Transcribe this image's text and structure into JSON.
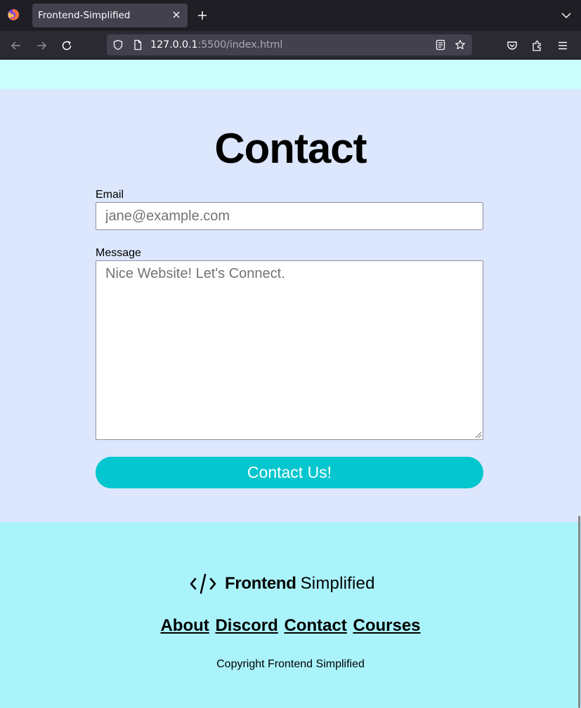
{
  "browser": {
    "tab_title": "Frontend-Simplified",
    "url_host": "127.0.0.1",
    "url_rest": ":5500/index.html"
  },
  "contact": {
    "title": "Contact",
    "email_label": "Email",
    "email_placeholder": "jane@example.com",
    "message_label": "Message",
    "message_placeholder": "Nice Website! Let's Connect.",
    "submit_label": "Contact Us!"
  },
  "footer": {
    "brand_bold": "Frontend",
    "brand_light": "Simplified",
    "links": [
      "About",
      "Discord",
      "Contact",
      "Courses"
    ],
    "copyright": "Copyright Frontend Simplified"
  },
  "colors": {
    "page_bg": "#dce7fd",
    "top_strip": "#ccfdfd",
    "footer_bg": "#aaf3fb",
    "button_bg": "#03c6cf"
  },
  "icons": [
    "firefox-logo-icon",
    "close-icon",
    "plus-icon",
    "chevron-down-icon",
    "back-arrow-icon",
    "forward-arrow-icon",
    "reload-icon",
    "shield-icon",
    "page-icon",
    "reader-view-icon",
    "star-icon",
    "pocket-icon",
    "extensions-icon",
    "menu-icon",
    "code-brackets-icon"
  ]
}
